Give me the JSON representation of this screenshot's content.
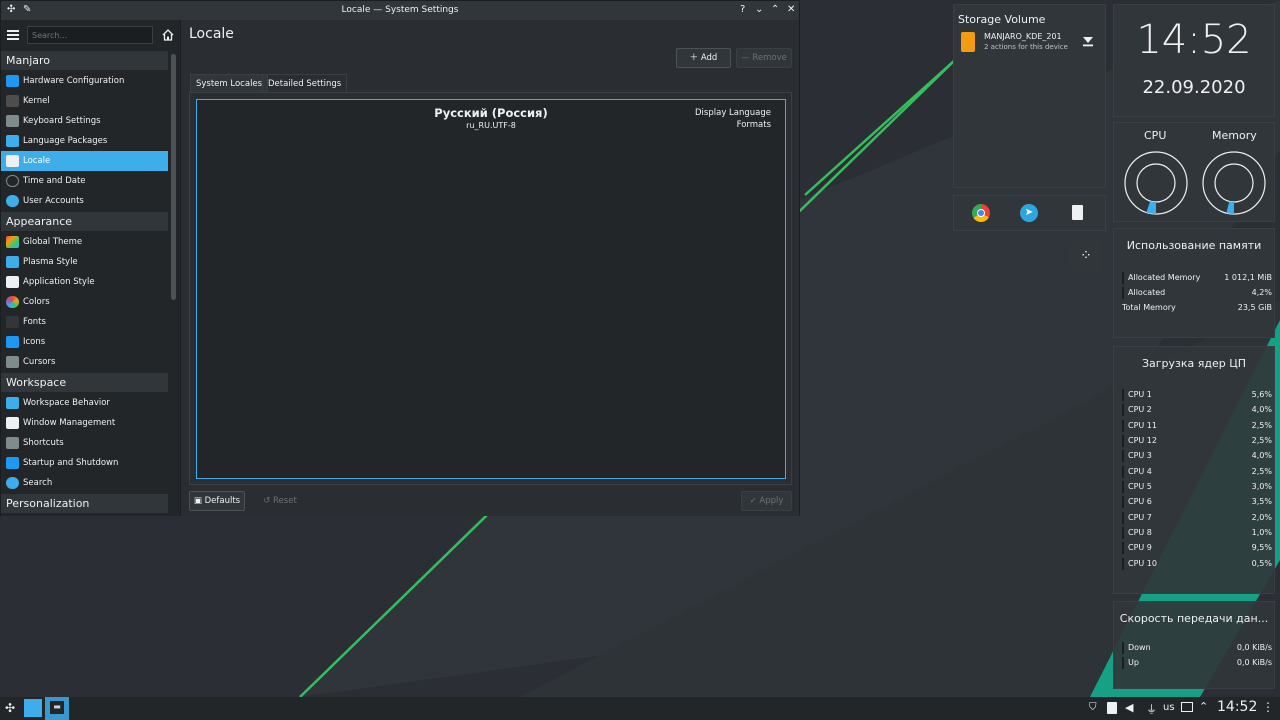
{
  "window": {
    "title": "Locale — System Settings",
    "help": "?",
    "minimize": "⌄",
    "maximize": "⌃",
    "close": "✕",
    "pin": "✎"
  },
  "sidebar": {
    "search_placeholder": "Search...",
    "categories": [
      {
        "label": "Manjaro",
        "items": [
          {
            "label": "Hardware Configuration",
            "icon": "hardware-icon",
            "color": "#1d99f3"
          },
          {
            "label": "Kernel",
            "icon": "kernel-icon",
            "color": "#4d4d4d"
          },
          {
            "label": "Keyboard Settings",
            "icon": "keyboard-icon",
            "color": "#7f8c8d"
          },
          {
            "label": "Language Packages",
            "icon": "language-packages-icon",
            "color": "#3daee9"
          },
          {
            "label": "Locale",
            "icon": "locale-icon",
            "color": "#1d99f3",
            "active": true
          },
          {
            "label": "Time and Date",
            "icon": "clock-icon",
            "color": "#232629"
          },
          {
            "label": "User Accounts",
            "icon": "user-icon",
            "color": "#3daee9"
          }
        ]
      },
      {
        "label": "Appearance",
        "items": [
          {
            "label": "Global Theme",
            "icon": "global-theme-icon",
            "color": "#e74c3c"
          },
          {
            "label": "Plasma Style",
            "icon": "plasma-style-icon",
            "color": "#3daee9"
          },
          {
            "label": "Application Style",
            "icon": "application-style-icon",
            "color": "#f39c12"
          },
          {
            "label": "Colors",
            "icon": "colors-icon",
            "color": "#e67e22"
          },
          {
            "label": "Fonts",
            "icon": "fonts-icon",
            "color": "#31363b"
          },
          {
            "label": "Icons",
            "icon": "icons-icon",
            "color": "#1d99f3"
          },
          {
            "label": "Cursors",
            "icon": "cursor-icon",
            "color": "#7f8c8d"
          }
        ]
      },
      {
        "label": "Workspace",
        "items": [
          {
            "label": "Workspace Behavior",
            "icon": "workspace-behavior-icon",
            "color": "#3daee9"
          },
          {
            "label": "Window Management",
            "icon": "window-management-icon",
            "color": "#eff0f1"
          },
          {
            "label": "Shortcuts",
            "icon": "shortcuts-icon",
            "color": "#7f8c8d"
          },
          {
            "label": "Startup and Shutdown",
            "icon": "startup-icon",
            "color": "#1d99f3"
          },
          {
            "label": "Search",
            "icon": "search-icon",
            "color": "#3daee9"
          }
        ]
      },
      {
        "label": "Personalization",
        "items": []
      }
    ]
  },
  "content": {
    "title": "Locale",
    "add_label": "Add",
    "remove_label": "Remove",
    "tabs": [
      "System Locales",
      "Detailed Settings"
    ],
    "locale": {
      "name": "Русский (Россия)",
      "code": "ru_RU.UTF-8",
      "roles": [
        "Display Language",
        "Formats"
      ]
    },
    "defaults_label": "Defaults",
    "reset_label": "Reset",
    "apply_label": "Apply"
  },
  "storage": {
    "title": "Storage Volume",
    "device": "MANJARO_KDE_201",
    "actions": "2 actions for this device"
  },
  "clock": {
    "time": "14:52",
    "date": "22.09.2020"
  },
  "gauges": {
    "cpu_label": "CPU",
    "memory_label": "Memory",
    "cpu_level": 0.05,
    "memory_level": 0.04
  },
  "memory_usage": {
    "title": "Использование памяти",
    "rows": [
      {
        "label": "Allocated Memory",
        "value": "1 012,1 MiB"
      },
      {
        "label": "Allocated",
        "value": "4,2%"
      },
      {
        "label": "Total Memory",
        "value": "23,5 GiB"
      }
    ]
  },
  "cpu_load": {
    "title": "Загрузка ядер ЦП",
    "rows": [
      {
        "label": "CPU 1",
        "value": "5,6%"
      },
      {
        "label": "CPU 2",
        "value": "4,0%"
      },
      {
        "label": "CPU 11",
        "value": "2,5%"
      },
      {
        "label": "CPU 12",
        "value": "2,5%"
      },
      {
        "label": "CPU 3",
        "value": "4,0%"
      },
      {
        "label": "CPU 4",
        "value": "2,5%"
      },
      {
        "label": "CPU 5",
        "value": "3,0%"
      },
      {
        "label": "CPU 6",
        "value": "3,5%"
      },
      {
        "label": "CPU 7",
        "value": "2,0%"
      },
      {
        "label": "CPU 8",
        "value": "1,0%"
      },
      {
        "label": "CPU 9",
        "value": "9,5%"
      },
      {
        "label": "CPU 10",
        "value": "0,5%"
      }
    ]
  },
  "network": {
    "title": "Скорость передачи дан...",
    "rows": [
      {
        "label": "Down",
        "value": "0,0 KiB/s"
      },
      {
        "label": "Up",
        "value": "0,0 KiB/s"
      }
    ]
  },
  "taskbar": {
    "keyboard_layout": "us",
    "time": "14:52"
  },
  "colors": {
    "accent": "#3daee9",
    "manjaro_green": "#35bf5c",
    "teal": "#16a085"
  }
}
